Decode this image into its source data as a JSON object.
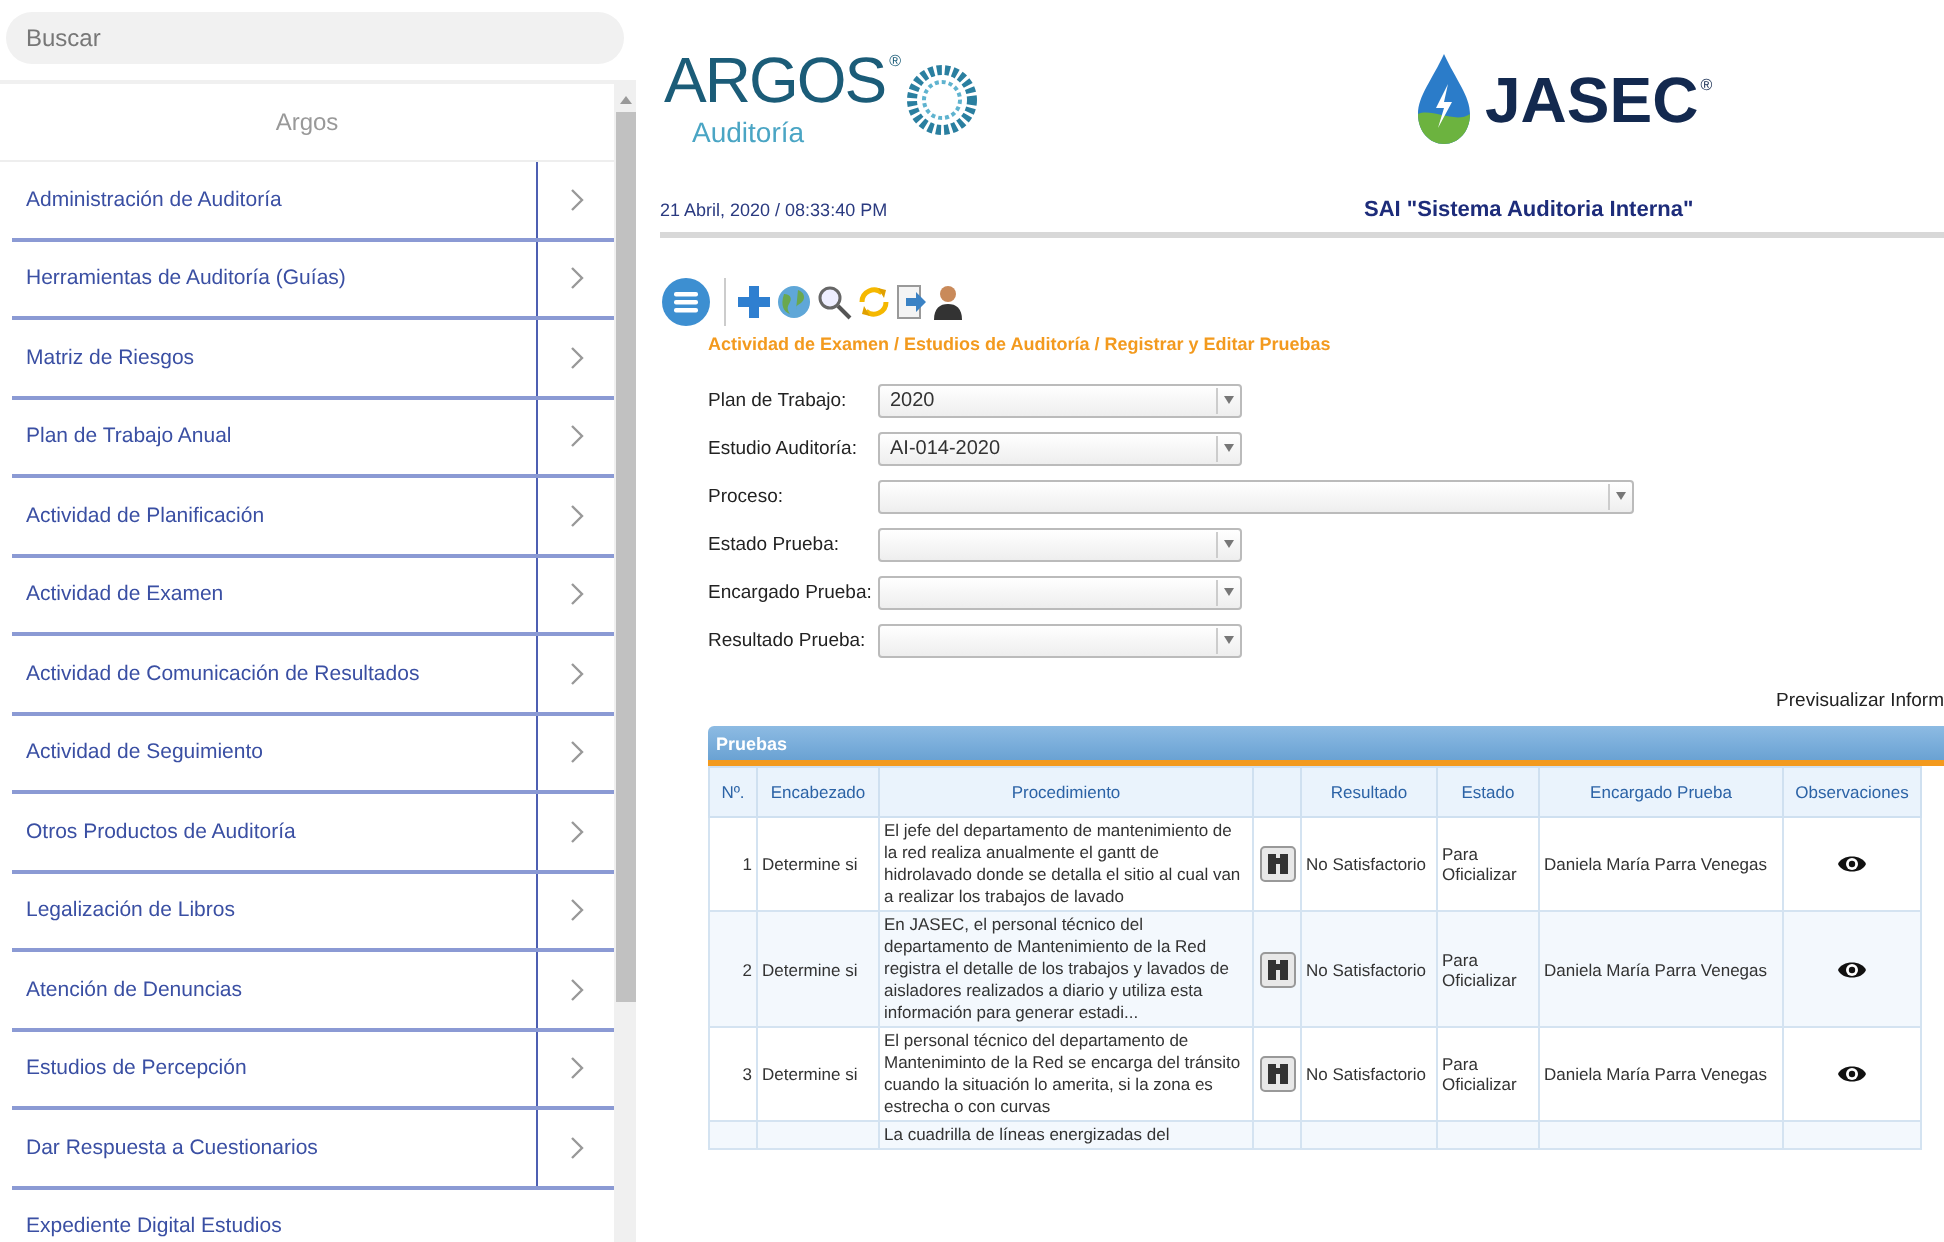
{
  "sidebar": {
    "search": {
      "placeholder": "Buscar"
    },
    "title": "Argos",
    "items": [
      {
        "label": "Administración de Auditoría",
        "kind": "submenu"
      },
      {
        "label": "Herramientas de Auditoría (Guías)",
        "kind": "submenu"
      },
      {
        "label": "Matriz de Riesgos",
        "kind": "submenu"
      },
      {
        "label": "Plan de Trabajo Anual",
        "kind": "submenu"
      },
      {
        "label": "Actividad de Planificación",
        "kind": "submenu"
      },
      {
        "label": "Actividad de Examen",
        "kind": "submenu"
      },
      {
        "label": "Actividad de Comunicación de Resultados",
        "kind": "submenu"
      },
      {
        "label": "Actividad de Seguimiento",
        "kind": "submenu"
      },
      {
        "label": "Otros Productos de Auditoría",
        "kind": "submenu"
      },
      {
        "label": "Legalización de Libros",
        "kind": "submenu"
      },
      {
        "label": "Atención de Denuncias",
        "kind": "submenu"
      },
      {
        "label": "Estudios de Percepción",
        "kind": "submenu"
      },
      {
        "label": "Dar Respuesta a Cuestionarios",
        "kind": "submenu"
      },
      {
        "label": "Expediente Digital Estudios",
        "kind": "link"
      }
    ]
  },
  "header": {
    "logo_left": {
      "name": "ARGOS",
      "mark": "®",
      "sub": "Auditoría"
    },
    "logo_right": {
      "name": "JASEC",
      "mark": "®"
    },
    "datetime": "21 Abril, 2020 / 08:33:40 PM",
    "system_title": "SAI \"Sistema Auditoria Interna\""
  },
  "breadcrumb": "Actividad de Examen / Estudios de Auditoría / Registrar y Editar Pruebas",
  "filters": [
    {
      "label": "Plan de Trabajo:",
      "value": "2020",
      "kind": "short"
    },
    {
      "label": "Estudio Auditoría:",
      "value": "AI-014-2020",
      "kind": "short"
    },
    {
      "label": "Proceso:",
      "kind": "long"
    },
    {
      "label": "Estado Prueba:",
      "kind": "short"
    },
    {
      "label": "Encargado Prueba:",
      "kind": "short"
    },
    {
      "label": "Resultado Prueba:",
      "kind": "short"
    }
  ],
  "preview_link": "Previsualizar Inform",
  "table": {
    "title": "Pruebas",
    "columns": [
      "Nº.",
      "Encabezado",
      "Procedimiento",
      "Resultado",
      "Estado",
      "Encargado Prueba",
      "Observaciones"
    ],
    "rows": [
      {
        "number": "1",
        "heading": "Determine si",
        "procedure": "El jefe del departamento de mantenimiento de la red realiza anualmente el gantt de hidrolavado donde se detalla el sitio al cual van a realizar los trabajos de lavado",
        "result": "No Satisfactorio",
        "status": "Para Oficializar",
        "owner": "Daniela María Parra Venegas"
      },
      {
        "number": "2",
        "heading": "Determine si",
        "procedure": "En JASEC, el personal técnico del departamento de Mantenimiento de la Red registra el detalle de los trabajos y lavados de aisladores realizados a diario y utiliza esta información para generar estadi...",
        "result": "No Satisfactorio",
        "status": "Para Oficializar",
        "owner": "Daniela María Parra Venegas"
      },
      {
        "number": "3",
        "heading": "Determine si",
        "procedure": "El personal técnico del departamento de Manteniminto de la Red se encarga del tránsito cuando la situación lo amerita, si la zona es estrecha o con curvas",
        "result": "No Satisfactorio",
        "status": "Para Oficializar",
        "owner": "Daniela María Parra Venegas"
      },
      {
        "procedure": "La cuadrilla de líneas energizadas del"
      }
    ]
  }
}
